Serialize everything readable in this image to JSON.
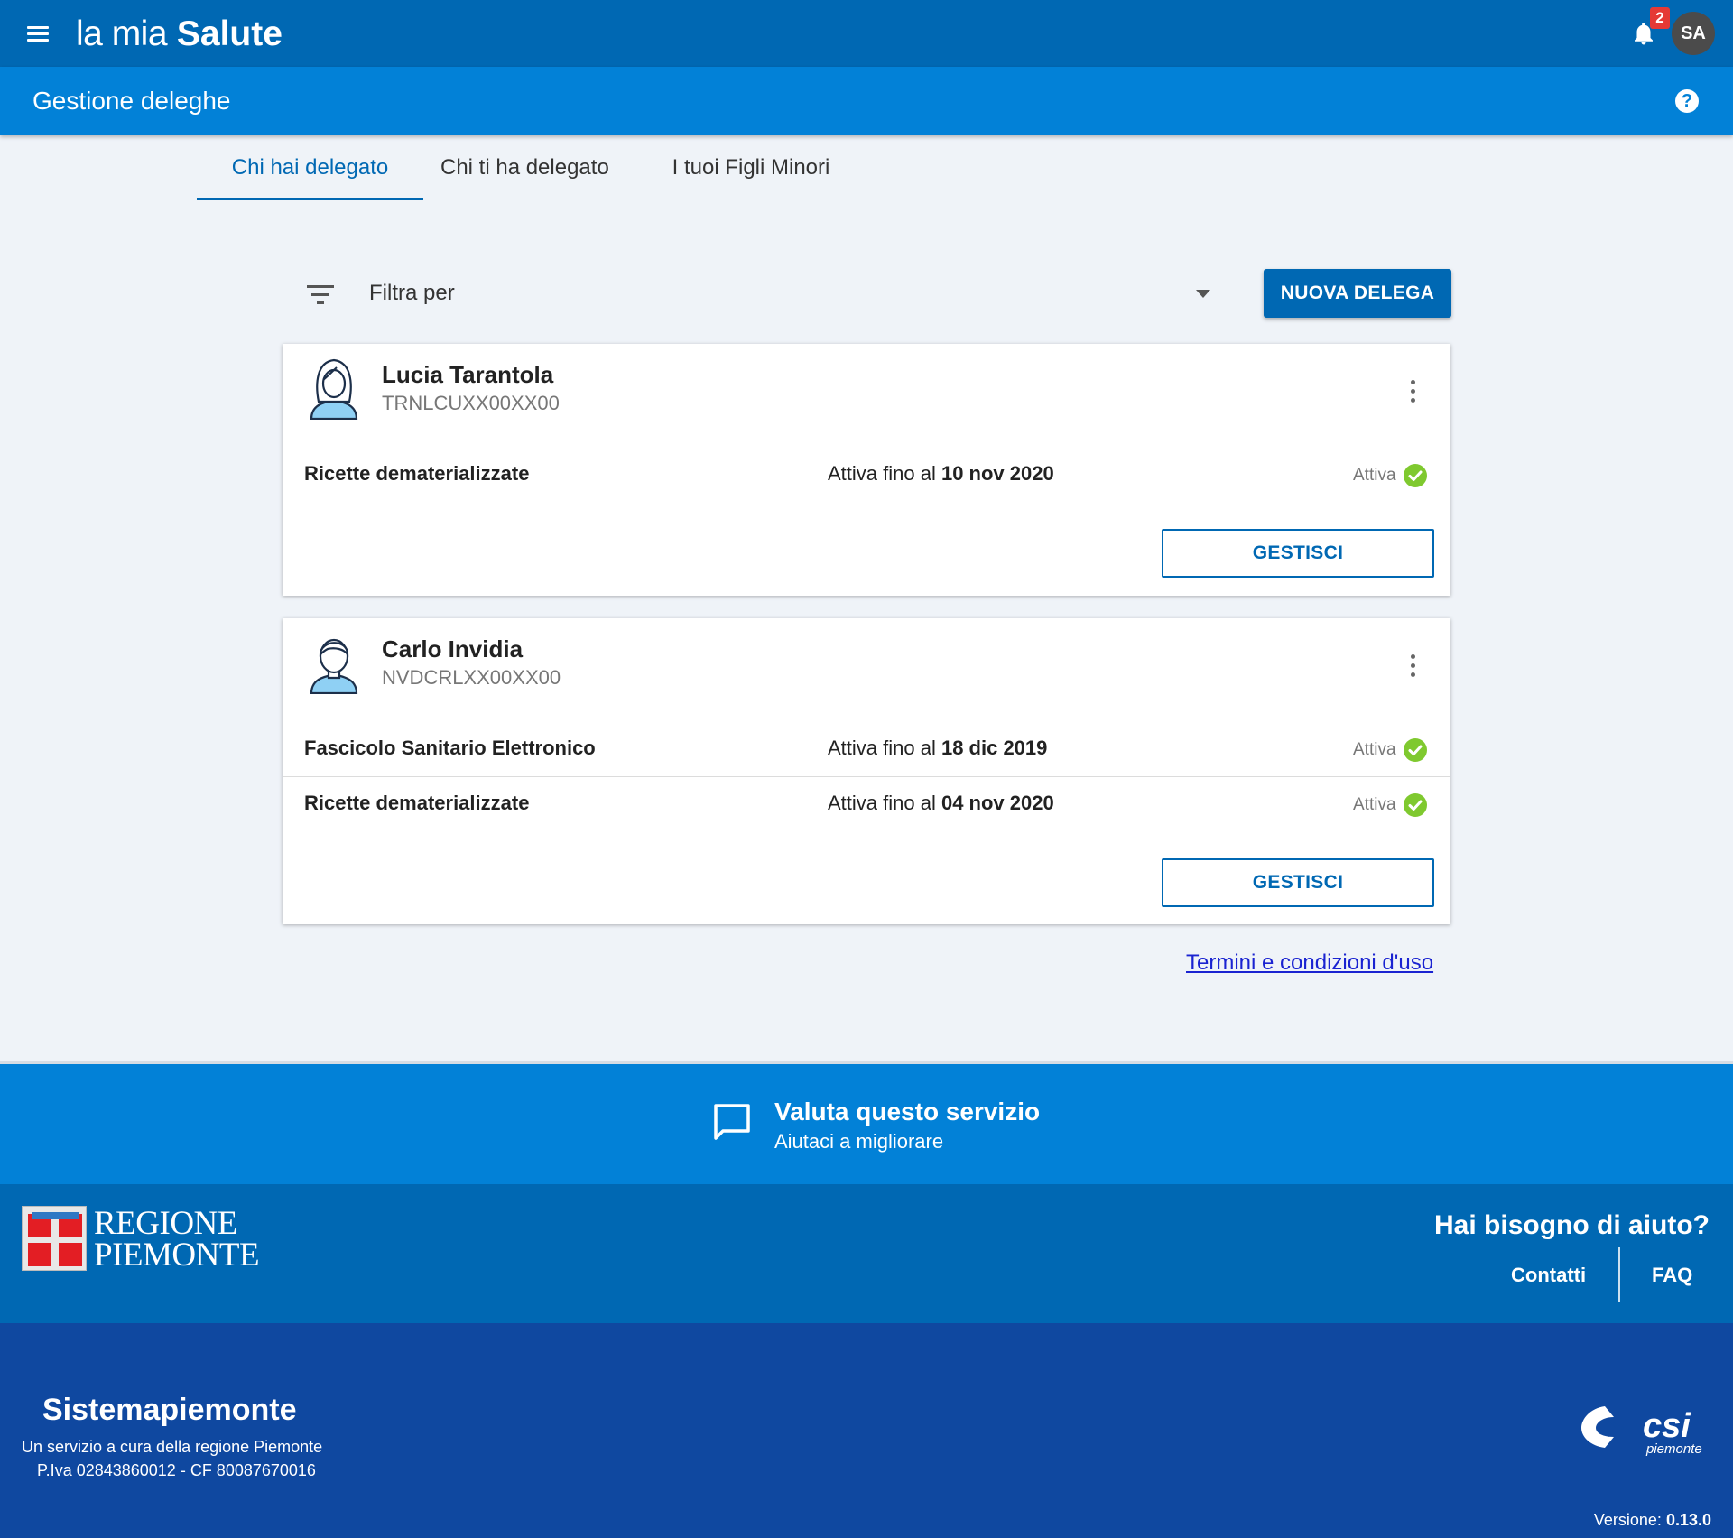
{
  "header": {
    "brand_pre": "la mia",
    "brand_post": "Salute",
    "notifications_count": "2",
    "user_initials": "SA"
  },
  "subheader": {
    "title": "Gestione deleghe"
  },
  "tabs": [
    {
      "label": "Chi hai delegato",
      "active": true
    },
    {
      "label": "Chi ti ha delegato",
      "active": false
    },
    {
      "label": "I tuoi Figli Minori",
      "active": false
    }
  ],
  "filter": {
    "label": "Filtra per"
  },
  "new_delegation_button": "NUOVA DELEGA",
  "cards": [
    {
      "name": "Lucia Tarantola",
      "tax_code": "TRNLCUXX00XX00",
      "avatar": "female-person-icon",
      "delegations": [
        {
          "service": "Ricette dematerializzate",
          "until_prefix": "Attiva fino al",
          "until_date": "10 nov 2020",
          "status": "Attiva"
        }
      ],
      "manage_label": "GESTISCI"
    },
    {
      "name": "Carlo Invidia",
      "tax_code": "NVDCRLXX00XX00",
      "avatar": "male-person-icon",
      "delegations": [
        {
          "service": "Fascicolo Sanitario Elettronico",
          "until_prefix": "Attiva fino al",
          "until_date": "18 dic 2019",
          "status": "Attiva"
        },
        {
          "service": "Ricette dematerializzate",
          "until_prefix": "Attiva fino al",
          "until_date": "04 nov 2020",
          "status": "Attiva"
        }
      ],
      "manage_label": "GESTISCI"
    }
  ],
  "terms_link": "Termini e condizioni d'uso",
  "feedback": {
    "title": "Valuta questo servizio",
    "subtitle": "Aiutaci a migliorare"
  },
  "help": {
    "region_logo_line1": "REGIONE",
    "region_logo_line2": "PIEMONTE",
    "title": "Hai bisogno di aiuto?",
    "contacts": "Contatti",
    "faq": "FAQ"
  },
  "footer": {
    "title": "Sistemapiemonte",
    "line1": "Un servizio a cura della regione Piemonte",
    "line2": "P.Iva 02843860012 - CF 80087670016",
    "logo_text": "csi",
    "logo_sub": "piemonte",
    "version_label": "Versione:",
    "version_value": "0.13.0"
  },
  "colors": {
    "topbar": "#0068b3",
    "subbar": "#0281d7",
    "footer": "#0f48a0",
    "status_ok": "#7fc92f"
  }
}
